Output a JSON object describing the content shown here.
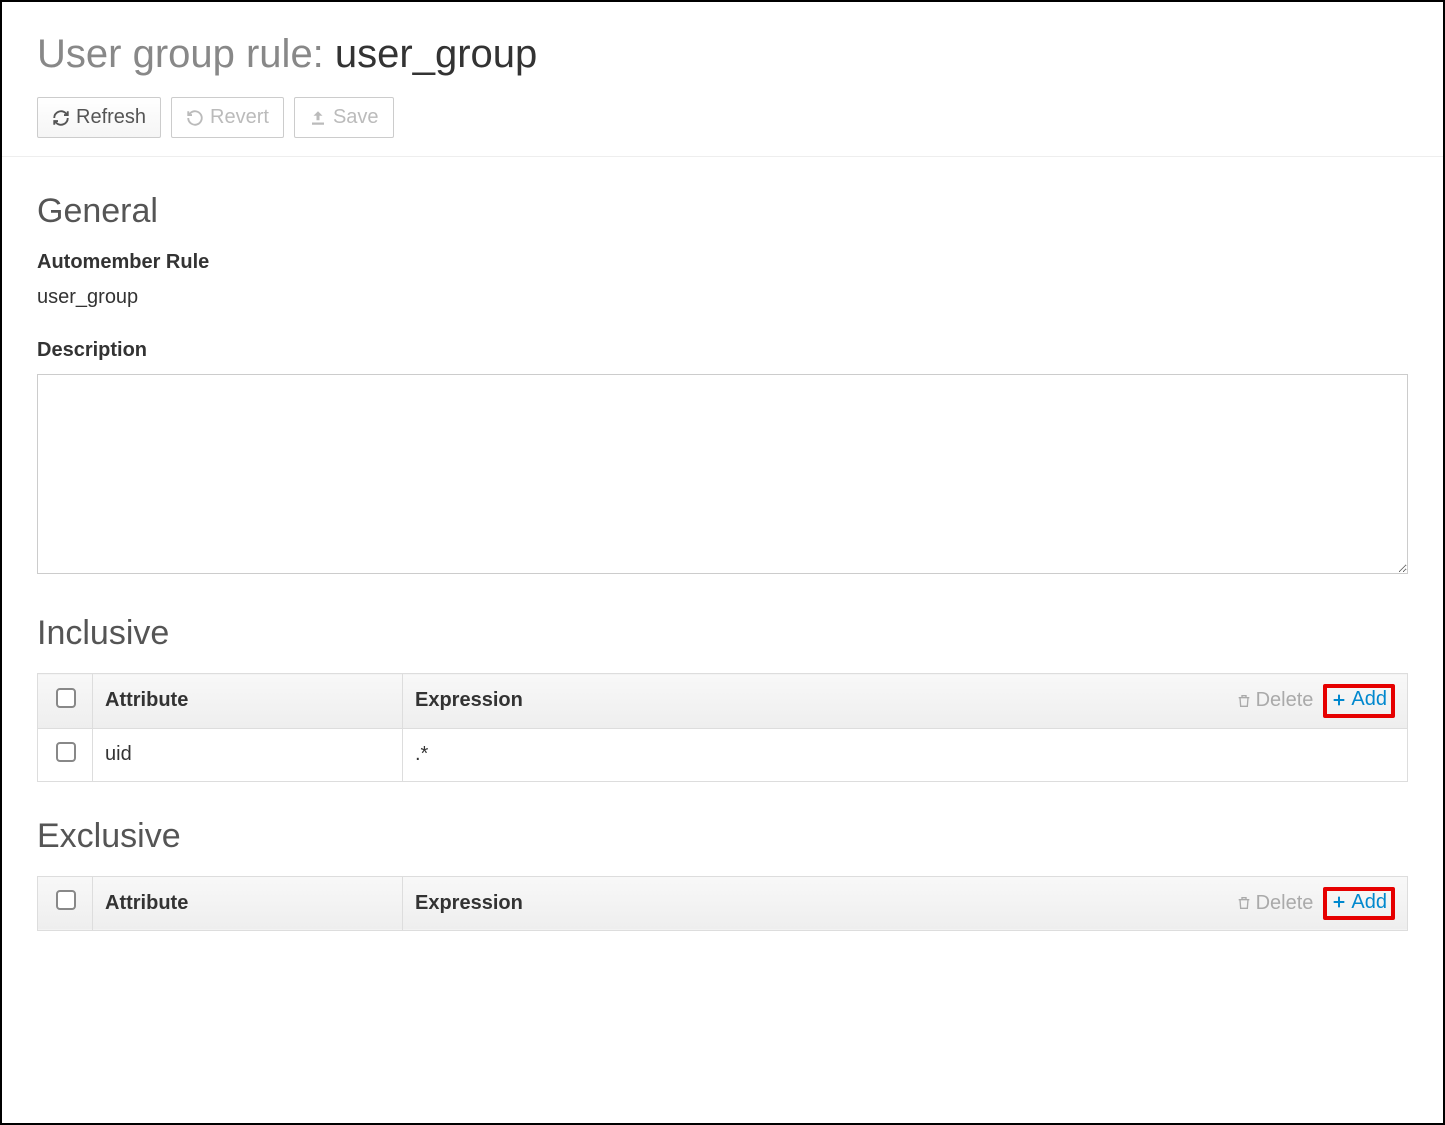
{
  "title": {
    "prefix": "User group rule: ",
    "name": "user_group"
  },
  "toolbar": {
    "refresh": "Refresh",
    "revert": "Revert",
    "save": "Save"
  },
  "sections": {
    "general": {
      "heading": "General",
      "automember_label": "Automember Rule",
      "automember_value": "user_group",
      "description_label": "Description",
      "description_value": ""
    },
    "inclusive": {
      "heading": "Inclusive",
      "columns": {
        "attribute": "Attribute",
        "expression": "Expression"
      },
      "actions": {
        "delete": "Delete",
        "add": "Add"
      },
      "rows": [
        {
          "attribute": "uid",
          "expression": ".*"
        }
      ]
    },
    "exclusive": {
      "heading": "Exclusive",
      "columns": {
        "attribute": "Attribute",
        "expression": "Expression"
      },
      "actions": {
        "delete": "Delete",
        "add": "Add"
      },
      "rows": []
    }
  }
}
